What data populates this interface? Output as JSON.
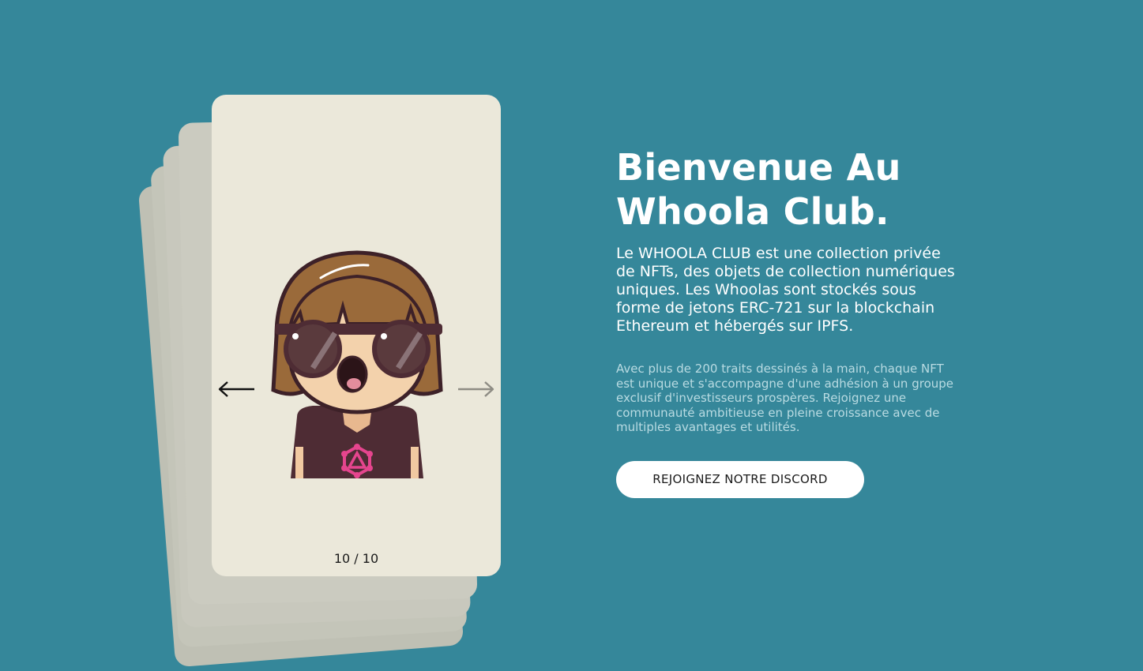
{
  "carousel": {
    "counter": "10 / 10",
    "prev_icon": "arrow-left-icon",
    "next_icon": "arrow-right-icon",
    "avatar_description": "cartoon-character-with-sunglasses"
  },
  "hero": {
    "title": "Bienvenue Au Whoola Club.",
    "intro": "Le WHOOLA CLUB est une collection privée de NFTs, des objets de collection numériques uniques. Les Whoolas sont stockés sous forme de jetons ERC-721 sur la blockchain Ethereum et hébergés sur IPFS.",
    "details": "Avec plus de 200 traits dessinés à la main, chaque NFT est unique et s'accompagne d'une adhésion à un groupe exclusif d'investisseurs prospères. Rejoignez une communauté ambitieuse en pleine croissance avec de multiples avantages et utilités.",
    "cta_label": "REJOIGNEZ NOTRE DISCORD"
  },
  "colors": {
    "background": "#35879a",
    "card": "#ebe8da",
    "button": "#ffffff"
  }
}
